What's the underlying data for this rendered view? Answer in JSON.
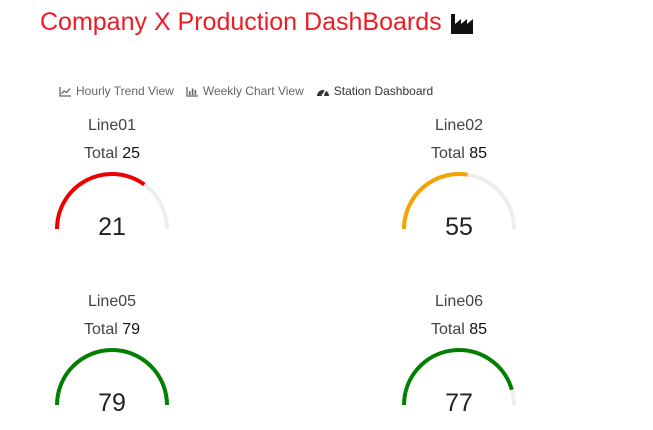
{
  "header": {
    "title": "Company X Production DashBoards",
    "title_color": "#ee1c25",
    "title_icon": "factory-icon"
  },
  "nav": {
    "tabs": [
      {
        "label": "Hourly Trend View",
        "icon": "line-chart-icon",
        "active": false
      },
      {
        "label": "Weekly Chart View",
        "icon": "bar-chart-icon",
        "active": false
      },
      {
        "label": "Station Dashboard",
        "icon": "dashboard-icon",
        "active": true
      }
    ]
  },
  "gauges": [
    {
      "name": "Line01",
      "total_label": "Total",
      "total": "25",
      "value": "21",
      "fraction": 0.7,
      "color": "#ee0000"
    },
    {
      "name": "Line02",
      "total_label": "Total",
      "total": "85",
      "value": "55",
      "fraction": 0.55,
      "color": "#f5a300"
    },
    {
      "name": "Line05",
      "total_label": "Total",
      "total": "79",
      "value": "79",
      "fraction": 1.0,
      "color": "#008000"
    },
    {
      "name": "Line06",
      "total_label": "Total",
      "total": "85",
      "value": "77",
      "fraction": 0.91,
      "color": "#008000"
    }
  ],
  "colors": {
    "track": "#eeeeee"
  }
}
